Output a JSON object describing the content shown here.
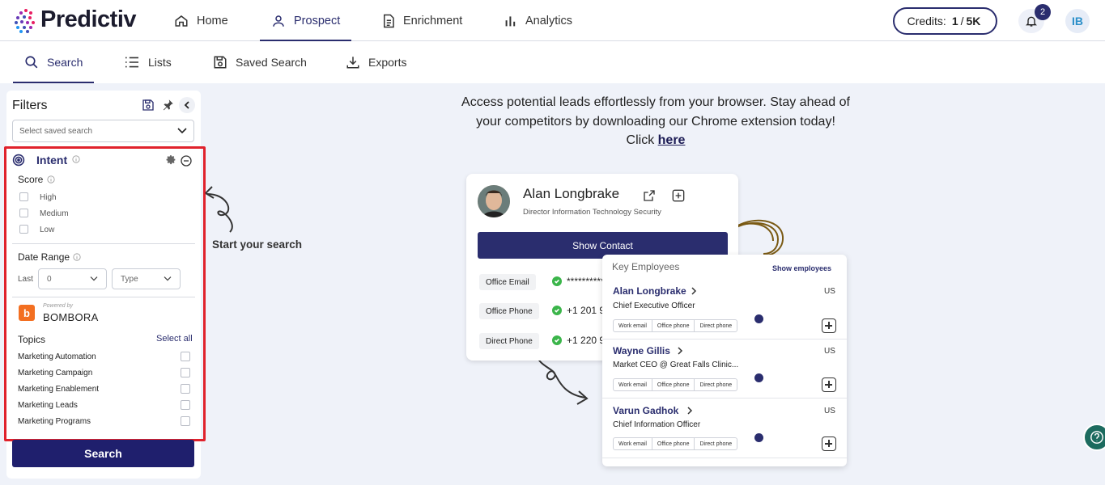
{
  "brand": {
    "name": "Predictiv"
  },
  "nav": {
    "items": [
      {
        "label": "Home"
      },
      {
        "label": "Prospect"
      },
      {
        "label": "Enrichment"
      },
      {
        "label": "Analytics"
      }
    ],
    "active": "Prospect"
  },
  "credits": {
    "prefix": "Credits:",
    "used": "1",
    "sep": "/",
    "total": "5K"
  },
  "notifications": {
    "count": "2"
  },
  "user": {
    "initials": "IB"
  },
  "subnav": {
    "items": [
      {
        "label": "Search"
      },
      {
        "label": "Lists"
      },
      {
        "label": "Saved Search"
      },
      {
        "label": "Exports"
      }
    ],
    "active": "Search"
  },
  "filters": {
    "title": "Filters",
    "saved_placeholder": "Select saved search",
    "intent": {
      "title": "Intent",
      "score_label": "Score",
      "score_options": [
        "High",
        "Medium",
        "Low"
      ],
      "date_range_label": "Date Range",
      "last_label": "Last",
      "last_value": "0",
      "type_placeholder": "Type",
      "powered_by": "Powered by",
      "provider": "BOMBORA",
      "topics_label": "Topics",
      "select_all": "Select all",
      "topics": [
        "Marketing Automation",
        "Marketing Campaign",
        "Marketing Enablement",
        "Marketing Leads",
        "Marketing Programs"
      ]
    },
    "search_button": "Search"
  },
  "promo": {
    "line1": "Access potential leads effortlessly from your browser. Stay ahead of",
    "line2": "your competitors by downloading our Chrome extension today!",
    "line3": "Click",
    "link": "here"
  },
  "hint": {
    "start": "Start your search"
  },
  "contact_card": {
    "name": "Alan Longbrake",
    "title": "Director Information Technology Security",
    "show_contact": "Show Contact",
    "rows": [
      {
        "label": "Office Email",
        "value": "**********"
      },
      {
        "label": "Office Phone",
        "value": "+1 201 9"
      },
      {
        "label": "Direct Phone",
        "value": "+1 220 9"
      }
    ]
  },
  "employees_card": {
    "title": "Key Employees",
    "show": "Show employees",
    "tags": [
      "Work email",
      "Office phone",
      "Direct phone"
    ],
    "employees": [
      {
        "name": "Alan Longbrake",
        "title": "Chief Executive Officer",
        "country": "US"
      },
      {
        "name": "Wayne Gillis",
        "title": "Market CEO @ Great Falls Clinic...",
        "country": "US"
      },
      {
        "name": "Varun Gadhok",
        "title": "Chief Information Officer",
        "country": "US"
      }
    ]
  },
  "colors": {
    "primary": "#2a2d6e",
    "highlight": "#e0222c",
    "success": "#3bb54a",
    "background": "#eff2f9"
  }
}
